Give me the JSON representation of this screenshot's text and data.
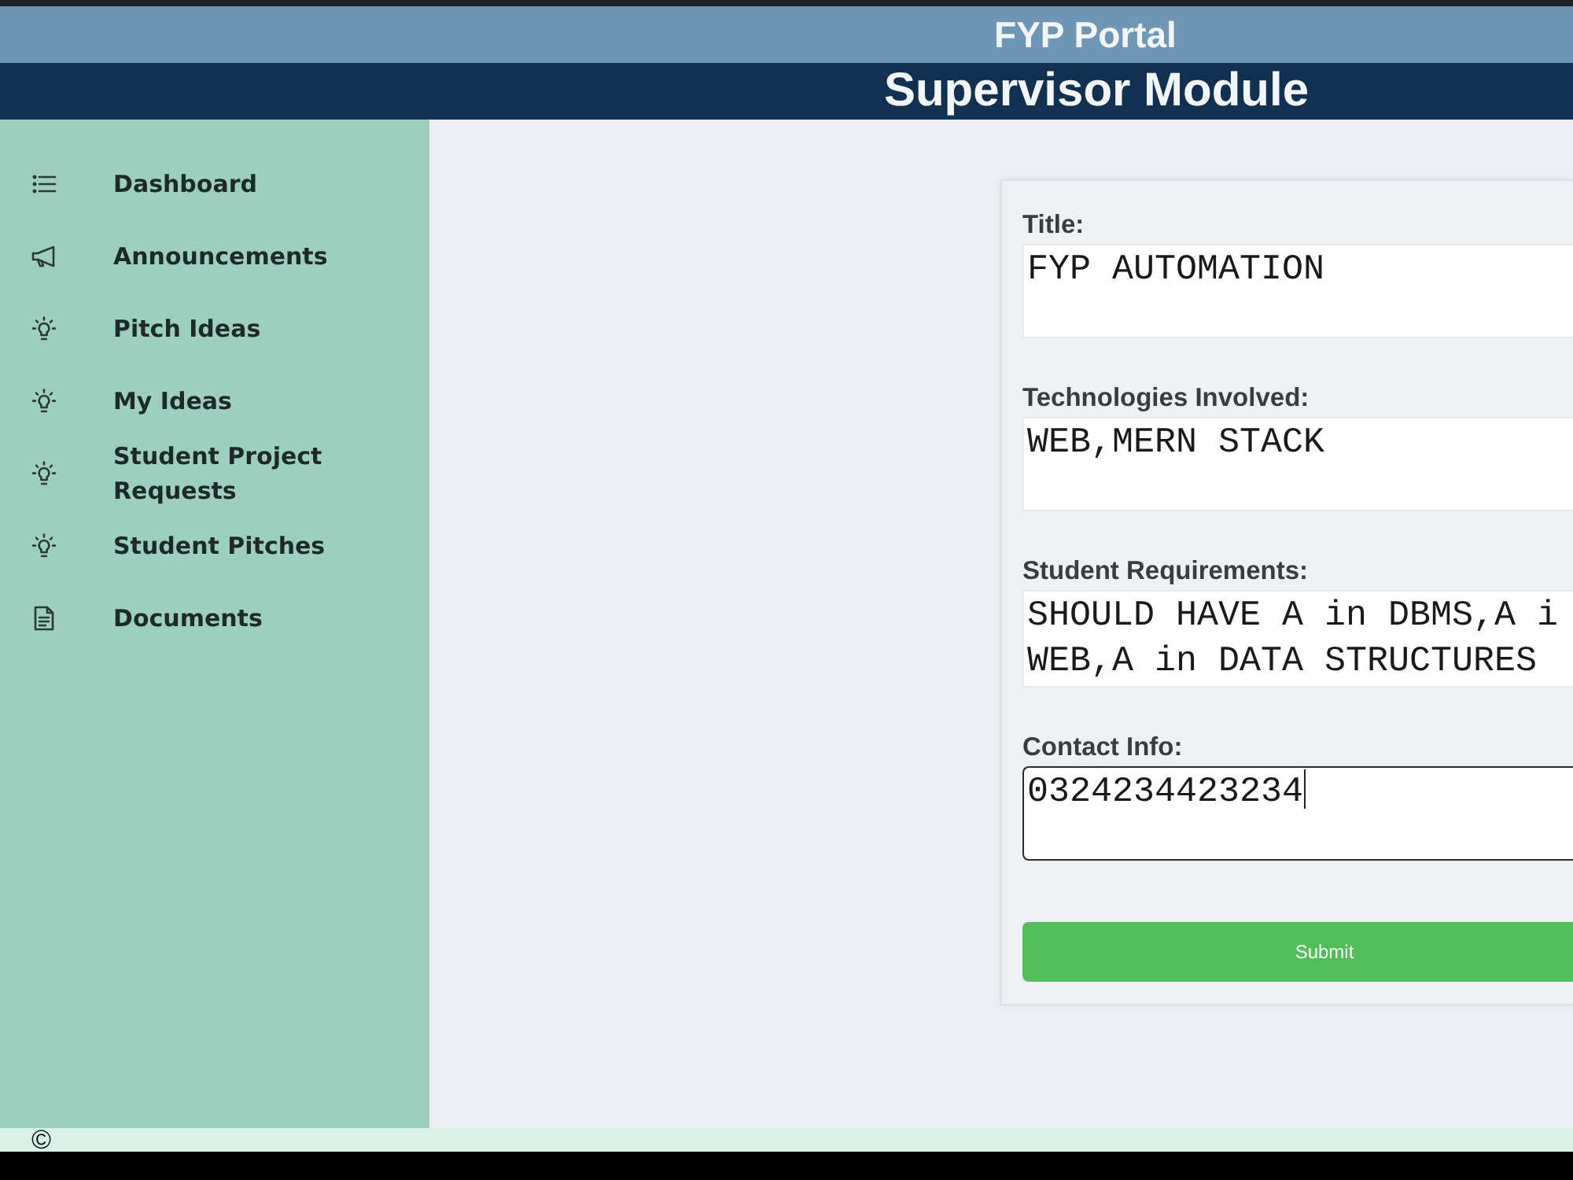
{
  "header": {
    "portal_title": "FYP Portal",
    "module_title": "Supervisor Module"
  },
  "sidebar": {
    "items": [
      {
        "label": "Dashboard",
        "kind": "list"
      },
      {
        "label": "Announcements",
        "kind": "megaphone"
      },
      {
        "label": "Pitch Ideas",
        "kind": "bulb"
      },
      {
        "label": "My Ideas",
        "kind": "bulb"
      },
      {
        "label": "Student Project Requests",
        "kind": "bulb"
      },
      {
        "label": "Student Pitches",
        "kind": "bulb"
      },
      {
        "label": "Documents",
        "kind": "document"
      }
    ]
  },
  "form": {
    "fields": [
      {
        "label": "Title:",
        "lines": [
          "FYP AUTOMATION"
        ],
        "focused": false
      },
      {
        "label": "Technologies Involved:",
        "lines": [
          "WEB,MERN STACK"
        ],
        "focused": false
      },
      {
        "label": "Student Requirements:",
        "lines": [
          "SHOULD HAVE A in DBMS,A i",
          "WEB,A in DATA STRUCTURES"
        ],
        "focused": false
      },
      {
        "label": "Contact Info:",
        "lines": [
          "0324234423234"
        ],
        "focused": true
      }
    ],
    "submit": "Submit"
  },
  "footer": {
    "text": "©"
  }
}
